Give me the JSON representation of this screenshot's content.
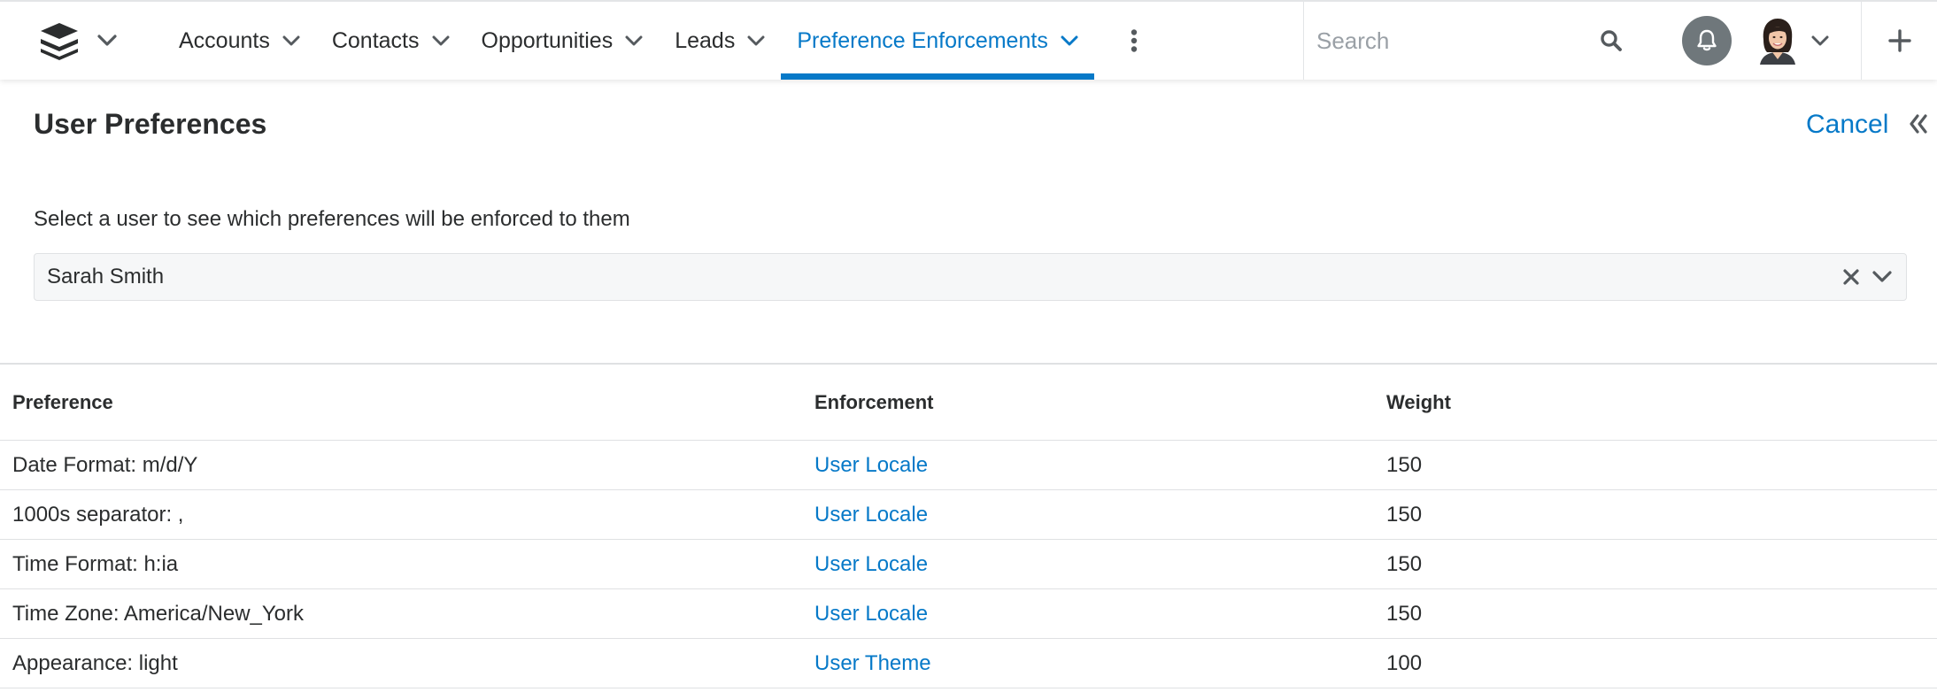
{
  "nav": {
    "items": [
      {
        "label": "Accounts",
        "active": false
      },
      {
        "label": "Contacts",
        "active": false
      },
      {
        "label": "Opportunities",
        "active": false
      },
      {
        "label": "Leads",
        "active": false
      },
      {
        "label": "Preference Enforcements",
        "active": true
      }
    ]
  },
  "search": {
    "placeholder": "Search",
    "value": ""
  },
  "page": {
    "title": "User Preferences",
    "cancel_label": "Cancel",
    "instruction": "Select a user to see which preferences will be enforced to them"
  },
  "user_select": {
    "value": "Sarah Smith"
  },
  "table": {
    "headers": [
      "Preference",
      "Enforcement",
      "Weight"
    ],
    "rows": [
      {
        "preference": "Date Format: m/d/Y",
        "enforcement": "User Locale",
        "weight": "150"
      },
      {
        "preference": "1000s separator: ,",
        "enforcement": "User Locale",
        "weight": "150"
      },
      {
        "preference": "Time Format: h:ia",
        "enforcement": "User Locale",
        "weight": "150"
      },
      {
        "preference": "Time Zone: America/New_York",
        "enforcement": "User Locale",
        "weight": "150"
      },
      {
        "preference": "Appearance: light",
        "enforcement": "User Theme",
        "weight": "100"
      }
    ]
  },
  "colors": {
    "accent": "#0679c8",
    "text": "#2b2d2e",
    "bell_bg": "#6f777b"
  },
  "icons": [
    "stack-logo-icon",
    "chevron-down-icon",
    "kebab-menu-icon",
    "search-icon",
    "bell-icon",
    "avatar",
    "plus-icon",
    "double-chevron-left-icon",
    "clear-x-icon"
  ]
}
